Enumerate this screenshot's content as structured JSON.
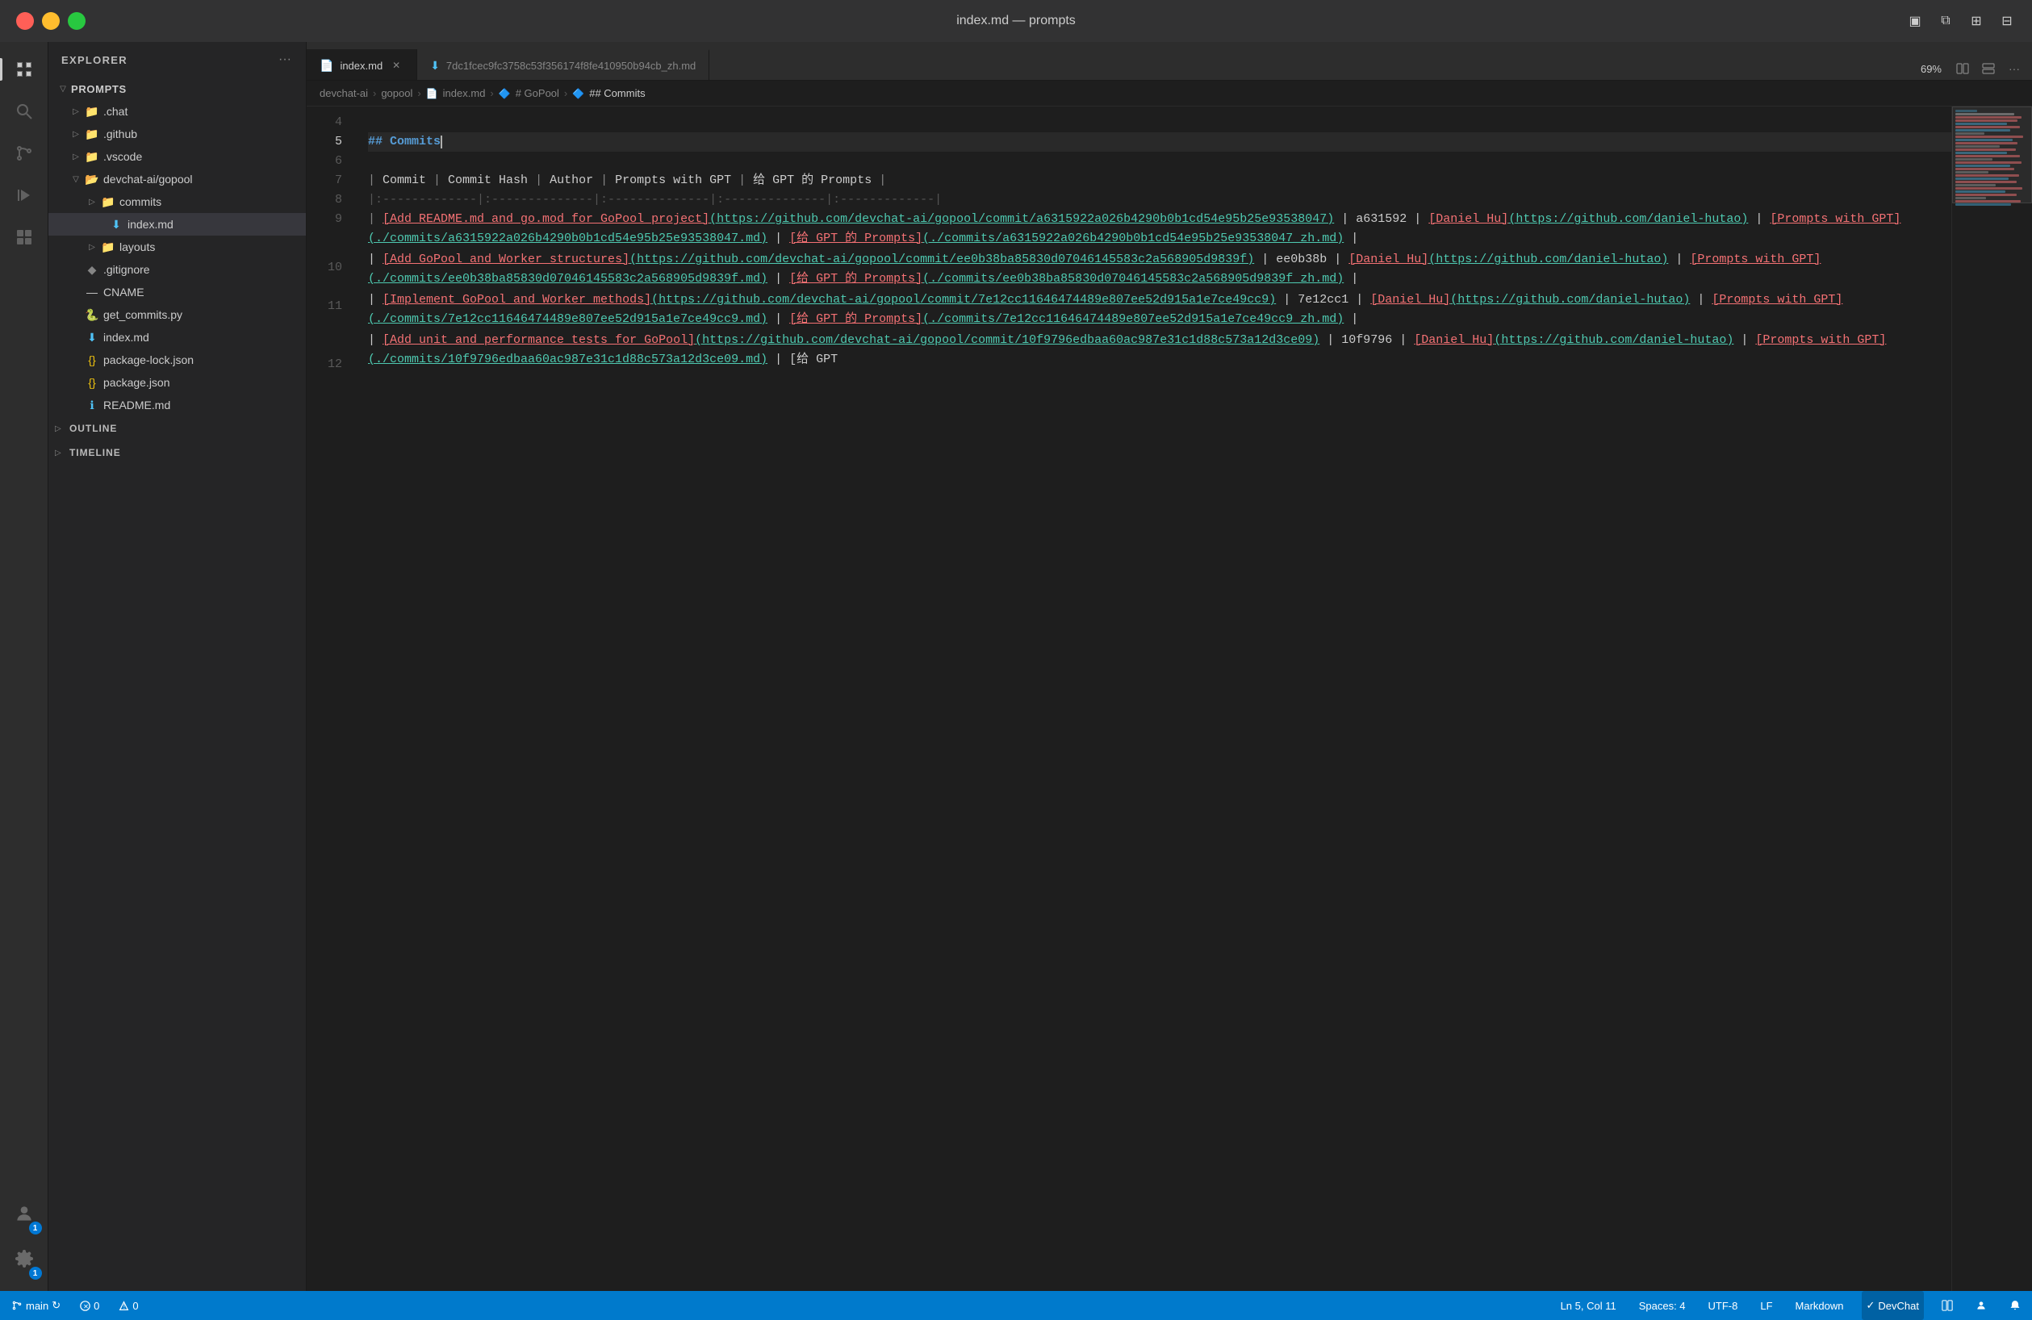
{
  "titlebar": {
    "title": "index.md — prompts",
    "traffic": [
      "close",
      "minimize",
      "maximize"
    ]
  },
  "tabs": [
    {
      "id": "tab-index",
      "label": "index.md",
      "active": true,
      "icon": "📄",
      "modified": false,
      "hasClose": true
    },
    {
      "id": "tab-hash",
      "label": "7dc1fcec9fc3758c53f356174f8fe410950b94cb_zh.md",
      "active": false,
      "icon": "⬇",
      "modified": false,
      "hasClose": false
    }
  ],
  "tabs_actions": {
    "zoom": "69%",
    "split_icon": "split",
    "more_icon": "more"
  },
  "breadcrumb": {
    "items": [
      {
        "label": "devchat-ai",
        "icon": ""
      },
      {
        "label": "gopool",
        "icon": ""
      },
      {
        "label": "index.md",
        "icon": "📄"
      },
      {
        "label": "# GoPool",
        "icon": "🔷"
      },
      {
        "label": "## Commits",
        "icon": "🔷"
      }
    ]
  },
  "editor": {
    "lines": [
      {
        "num": 4,
        "content": "",
        "type": "empty"
      },
      {
        "num": 5,
        "content": "## Commits",
        "type": "heading",
        "cursor": true
      },
      {
        "num": 6,
        "content": "",
        "type": "empty"
      },
      {
        "num": 7,
        "content": "| Commit | Commit Hash | Author | Prompts with GPT | 给 GPT 的 Prompts |",
        "type": "table-header"
      },
      {
        "num": 8,
        "content": "|:-------------|:--------------|:--------------|:--------------|:-------------|",
        "type": "table-sep"
      },
      {
        "num": 9,
        "content_parts": [
          {
            "text": "| [Add README.md and go.mod for GoPool project]",
            "class": "md-pipe"
          },
          {
            "text": "(https://github.com/devchat-ai/gopool/commit/a6315922a026b4290b0b1cd54e95b25e93538047)",
            "class": "md-link"
          },
          {
            "text": " | a631592 | ",
            "class": "md-text"
          },
          {
            "text": "[Daniel Hu]",
            "class": "md-link-red"
          },
          {
            "text": "(https://github.com/daniel-hutao)",
            "class": "md-link"
          },
          {
            "text": " | ",
            "class": "md-text"
          },
          {
            "text": "[Prompts with GPT]",
            "class": "md-link-red"
          },
          {
            "text": "(./commits/a6315922a026b4290b0b1cd54e95b25e93538047.md)",
            "class": "md-link"
          },
          {
            "text": " | [给 GPT 的 Prompts]",
            "class": "md-link-red"
          },
          {
            "text": "(./commits/a6315922a026b4290b0b1cd54e95b25e93538047_zh.md)",
            "class": "md-link"
          },
          {
            "text": " |",
            "class": "md-text"
          }
        ]
      },
      {
        "num": 10,
        "content_parts": [
          {
            "text": "| ",
            "class": "md-text"
          },
          {
            "text": "[Add GoPool and Worker structures]",
            "class": "md-link-red"
          },
          {
            "text": "(https://github.com/devchat-ai/gopool/commit/ee0b38ba85830d07046145583c2a568905d9839f)",
            "class": "md-link"
          },
          {
            "text": " | ee0b38b | ",
            "class": "md-text"
          },
          {
            "text": "[Daniel Hu]",
            "class": "md-link-red"
          },
          {
            "text": "(https://github.com/daniel-hutao)",
            "class": "md-link"
          },
          {
            "text": " | ",
            "class": "md-text"
          },
          {
            "text": "[Prompts with GPT]",
            "class": "md-link-red"
          },
          {
            "text": "(./commits/ee0b38ba85830d07046145583c2a568905d9839f.md)",
            "class": "md-link"
          },
          {
            "text": " | [给 GPT 的 Prompts]",
            "class": "md-link-red"
          },
          {
            "text": "(./commits/ee0b38ba85830d07046145583c2a568905d9839f_zh.md)",
            "class": "md-link"
          },
          {
            "text": " |",
            "class": "md-text"
          }
        ]
      },
      {
        "num": 11,
        "content_parts": [
          {
            "text": "| ",
            "class": "md-text"
          },
          {
            "text": "[Implement GoPool and Worker methods]",
            "class": "md-link-red"
          },
          {
            "text": "(https://github.com/devchat-ai/gopool/commit/7e12cc11646474489e807ee52d915a1e7ce49cc9)",
            "class": "md-link"
          },
          {
            "text": " | 7e12cc1 | ",
            "class": "md-text"
          },
          {
            "text": "[Daniel Hu]",
            "class": "md-link-red"
          },
          {
            "text": "(https://github.com/daniel-hutao)",
            "class": "md-link"
          },
          {
            "text": " | ",
            "class": "md-text"
          },
          {
            "text": "[Prompts with GPT]",
            "class": "md-link-red"
          },
          {
            "text": "(./commits/7e12cc11646474489e807ee52d915a1e7ce49cc9.md)",
            "class": "md-link"
          },
          {
            "text": " | [给 GPT 的 Prompts]",
            "class": "md-link-red"
          },
          {
            "text": "(./commits/7e12cc11646474489e807ee52d915a1e7ce49cc9_zh.md)",
            "class": "md-link"
          },
          {
            "text": " |",
            "class": "md-text"
          }
        ]
      },
      {
        "num": 12,
        "content_parts": [
          {
            "text": "| ",
            "class": "md-text"
          },
          {
            "text": "[Add unit and performance tests for GoPool]",
            "class": "md-link-red"
          },
          {
            "text": "(https://github.com/devchat-ai/gopool/commit/10f9796edbaa60ac987e31c1d88c573a12d3ce09)",
            "class": "md-link"
          },
          {
            "text": " | 10f9796 | ",
            "class": "md-text"
          },
          {
            "text": "[Daniel Hu]",
            "class": "md-link-red"
          },
          {
            "text": "(https://github.com/daniel-hutao)",
            "class": "md-link"
          },
          {
            "text": " | ",
            "class": "md-text"
          },
          {
            "text": "[Prompts with GPT]",
            "class": "md-link-red"
          },
          {
            "text": "(./commits/10f9796edbaa60ac987e31c1d88c573a12d3ce09.md)",
            "class": "md-link"
          },
          {
            "text": " | [给 GPT",
            "class": "md-text"
          }
        ]
      }
    ]
  },
  "sidebar": {
    "title": "EXPLORER",
    "more_icon": "···",
    "root": {
      "label": "PROMPTS",
      "expanded": true
    },
    "items": [
      {
        "type": "folder",
        "label": ".chat",
        "indent": 1,
        "expanded": false,
        "icon": "▷"
      },
      {
        "type": "folder",
        "label": ".github",
        "indent": 1,
        "expanded": false,
        "icon": "▷"
      },
      {
        "type": "folder",
        "label": ".vscode",
        "indent": 1,
        "expanded": false,
        "icon": "▷"
      },
      {
        "type": "folder",
        "label": "devchat-ai/gopool",
        "indent": 1,
        "expanded": true,
        "icon": "▽"
      },
      {
        "type": "folder",
        "label": "commits",
        "indent": 2,
        "expanded": false,
        "icon": "▷"
      },
      {
        "type": "file",
        "label": "index.md",
        "indent": 3,
        "selected": true,
        "color": "#4fc3f7",
        "icon": "📄"
      },
      {
        "type": "folder",
        "label": "layouts",
        "indent": 2,
        "expanded": false,
        "icon": "▷"
      },
      {
        "type": "file",
        "label": ".gitignore",
        "indent": 1,
        "icon": "◆",
        "color": "#858585"
      },
      {
        "type": "file",
        "label": "CNAME",
        "indent": 1,
        "icon": "",
        "color": "#cccccc"
      },
      {
        "type": "file",
        "label": "get_commits.py",
        "indent": 1,
        "icon": "🐍",
        "color": "#cccccc"
      },
      {
        "type": "file",
        "label": "index.md",
        "indent": 1,
        "icon": "📄",
        "color": "#4fc3f7"
      },
      {
        "type": "file",
        "label": "package-lock.json",
        "indent": 1,
        "icon": "{}",
        "color": "#cccccc"
      },
      {
        "type": "file",
        "label": "package.json",
        "indent": 1,
        "icon": "{}",
        "color": "#cccccc"
      },
      {
        "type": "file",
        "label": "README.md",
        "indent": 1,
        "icon": "ℹ",
        "color": "#4fc3f7"
      }
    ],
    "outline": {
      "label": "OUTLINE",
      "expanded": false
    },
    "timeline": {
      "label": "TIMELINE",
      "expanded": false
    }
  },
  "activity": {
    "items": [
      {
        "icon": "files",
        "active": true
      },
      {
        "icon": "search",
        "active": false
      },
      {
        "icon": "git",
        "active": false
      },
      {
        "icon": "run",
        "active": false
      },
      {
        "icon": "extensions",
        "active": false
      }
    ],
    "bottom": [
      {
        "icon": "user",
        "badge": "1"
      },
      {
        "icon": "settings",
        "badge": "1"
      }
    ]
  },
  "statusbar": {
    "left": [
      {
        "label": "⎇ main",
        "extra": "↻"
      },
      {
        "label": "⊗ 0"
      },
      {
        "label": "⚠ 0"
      }
    ],
    "right": [
      {
        "label": "Ln 5, Col 11"
      },
      {
        "label": "Spaces: 4"
      },
      {
        "label": "UTF-8"
      },
      {
        "label": "LF"
      },
      {
        "label": "Markdown"
      },
      {
        "label": "✓ DevChat"
      },
      {
        "label": "🔲"
      },
      {
        "label": "👤"
      },
      {
        "label": "🔔"
      }
    ]
  }
}
